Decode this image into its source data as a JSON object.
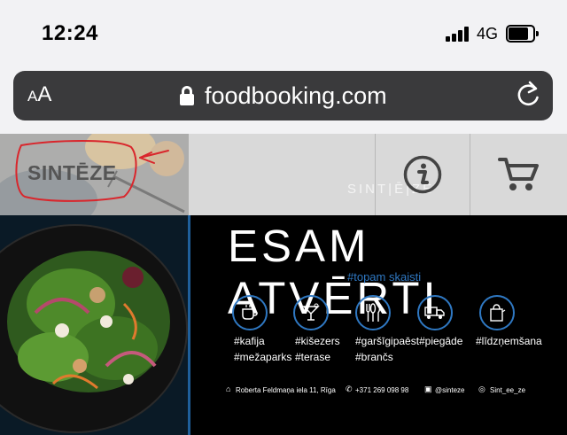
{
  "status_bar": {
    "time": "12:24",
    "network": "4G"
  },
  "address_bar": {
    "text_size_small": "A",
    "text_size_large": "A",
    "url": "foodbooking.com"
  },
  "site_header": {
    "logo_text": "SINTĒZE",
    "background_brand": "SINT|Ē|ZE"
  },
  "banner": {
    "headline": "ESAM ATVĒRTI",
    "tagline": "#topam skaisti",
    "services": [
      {
        "icon": "coffee-cup-icon",
        "labels": [
          "#kafija",
          "#mežaparks"
        ]
      },
      {
        "icon": "cocktail-glass-icon",
        "labels": [
          "#kišezers",
          "#terase"
        ]
      },
      {
        "icon": "cutlery-icon",
        "labels": [
          "#garšīgipaēst",
          "#brančs"
        ]
      },
      {
        "icon": "delivery-truck-icon",
        "labels": [
          "#piegāde"
        ]
      },
      {
        "icon": "takeaway-bag-icon",
        "labels": [
          "#līdzņemšana"
        ]
      }
    ],
    "footer": {
      "address": "Roberta Feldmaņa iela 11, Rīga",
      "phone": "+371 269 098 98",
      "facebook": "@sinteze",
      "instagram": "Sint_ee_ze"
    }
  },
  "colors": {
    "accent_blue": "#2f78c2",
    "annotation_red": "#d9262c",
    "address_bar": "#3a3a3c"
  }
}
